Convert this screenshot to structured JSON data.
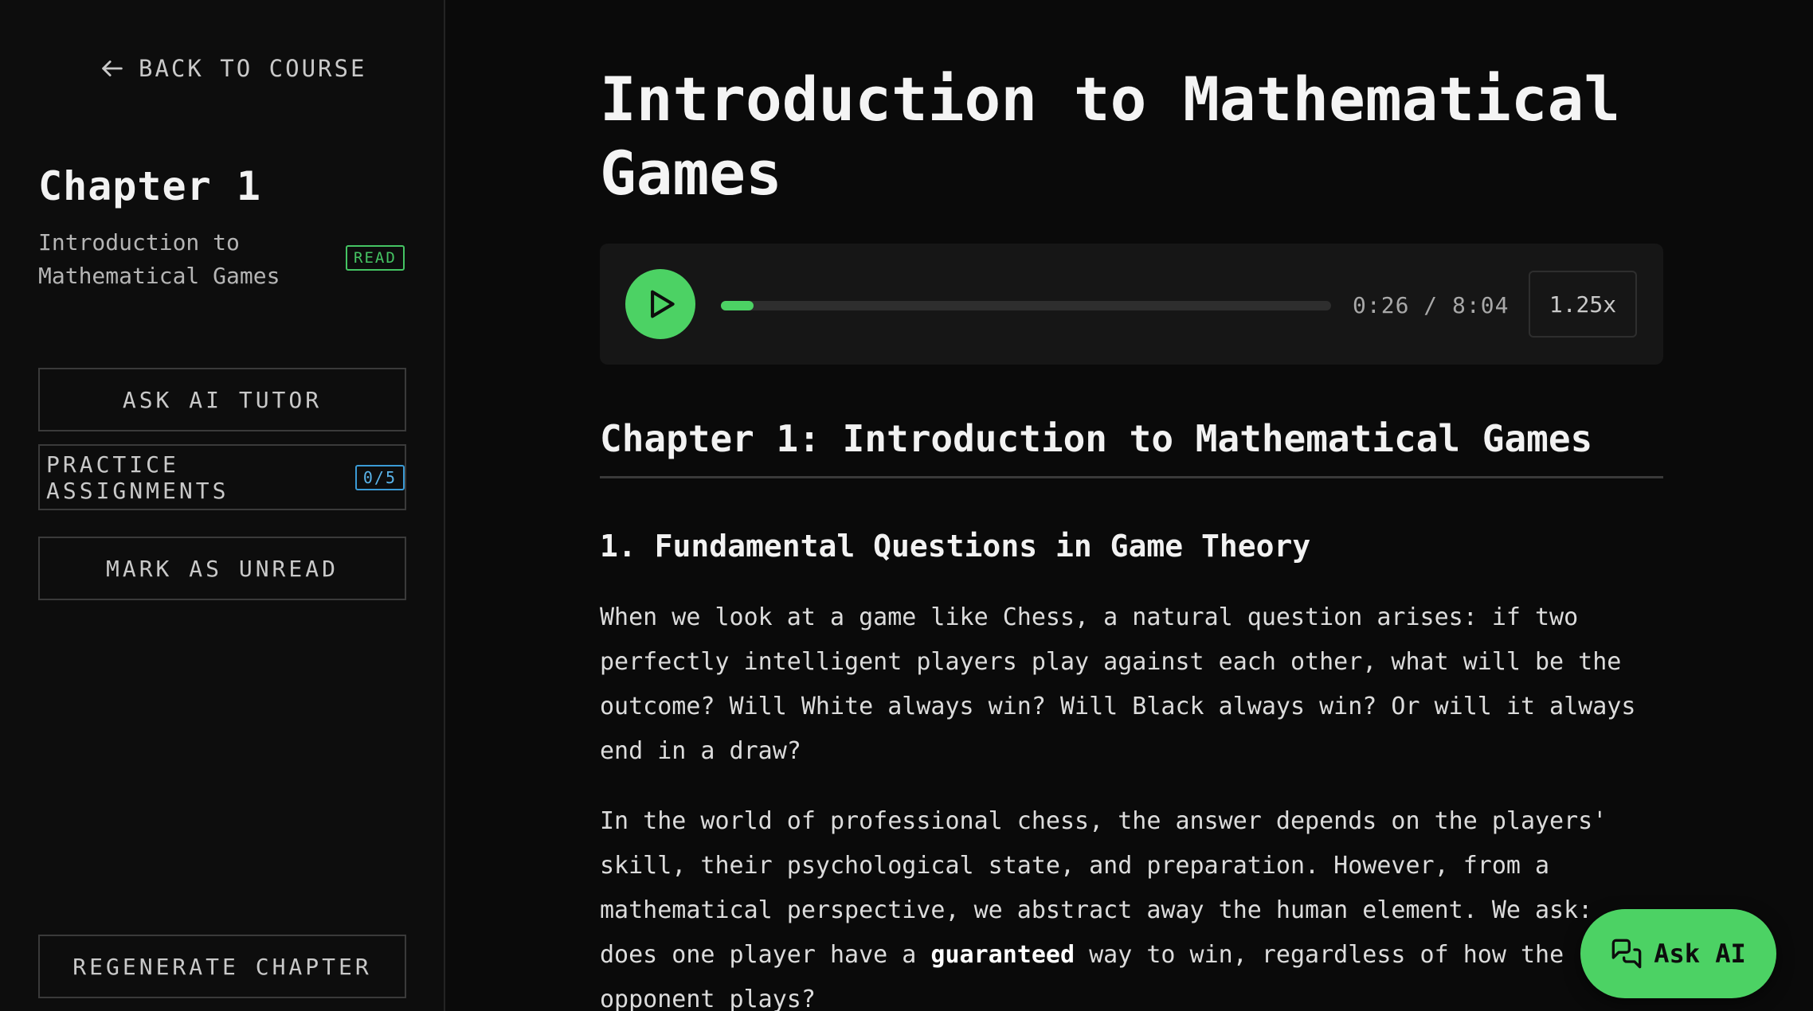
{
  "sidebar": {
    "back_label": "BACK TO COURSE",
    "chapter_heading": "Chapter 1",
    "chapter_subtitle": "Introduction to Mathematical Games",
    "read_badge": "READ",
    "ask_tutor_label": "ASK AI TUTOR",
    "practice_label": "PRACTICE ASSIGNMENTS",
    "practice_count": "0/5",
    "mark_unread_label": "MARK AS UNREAD",
    "regenerate_label": "REGENERATE CHAPTER"
  },
  "main": {
    "title": "Introduction to Mathematical Games",
    "player": {
      "time": "0:26 / 8:04",
      "progress_fraction": 0.054,
      "speed": "1.25x"
    },
    "section_title": "Chapter 1: Introduction to Mathematical Games",
    "subsection_title": "1. Fundamental Questions in Game Theory",
    "para1": "When we look at a game like Chess, a natural question arises: if two perfectly intelligent players play against each other, what will be the outcome? Will White always win? Will Black always win? Or will it always end in a draw?",
    "para2_start": "In the world of professional chess, the answer depends on the players' skill, their psychological state, and preparation. However, from a mathematical perspective, we abstract away the human element. We ask: does one player have a ",
    "para2_bold": "guaranteed",
    "para2_end": " way to win, regardless of how the opponent plays?"
  },
  "ask_ai_label": "Ask AI",
  "colors": {
    "accent": "#4cd264",
    "badge_blue": "#3b9bd6"
  },
  "icons": [
    "arrow-left-icon",
    "play-icon",
    "chat-bubbles-icon"
  ]
}
